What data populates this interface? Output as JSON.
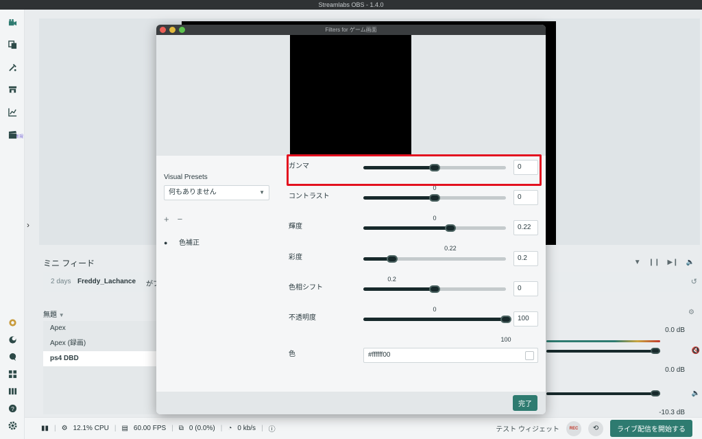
{
  "app": {
    "title": "Streamlabs OBS - 1.4.0"
  },
  "sidebar": {
    "icons": [
      "camera-icon",
      "copy-icon",
      "themes-icon",
      "store-icon",
      "chart-icon",
      "clapper-icon"
    ],
    "new_badge": "新規",
    "bottom_icons": [
      "studio-icon",
      "moon-icon",
      "chat-icon",
      "layout-icon",
      "library-icon",
      "help-icon",
      "settings-icon"
    ]
  },
  "mini_feed": {
    "title": "ミニ フィード",
    "row": {
      "time": "2 days",
      "user": "Freddy_Lachance",
      "text": "がフ"
    }
  },
  "scenes": {
    "selector": "無題",
    "items": [
      "Apex",
      "Apex (録画)",
      "ps4 DBD"
    ]
  },
  "mixer": {
    "db_values": [
      "0.0 dB",
      "0.0 dB",
      "-10.3 dB"
    ]
  },
  "statusbar": {
    "cpu": "12.1% CPU",
    "fps": "60.00 FPS",
    "dropped": "0 (0.0%)",
    "bitrate": "0 kb/s",
    "test_widget": "テスト ウィジェット",
    "rec_label": "REC",
    "go_live": "ライブ配信を開始する"
  },
  "modal": {
    "title": "Filters for ゲーム画面",
    "visual_presets_label": "Visual Presets",
    "visual_presets_value": "何もありません",
    "add_symbol": "+",
    "remove_symbol": "−",
    "filter_name": "色補正",
    "props": [
      {
        "label": "ガンマ",
        "value": "0",
        "fraction": 0.5
      },
      {
        "label": "コントラスト",
        "value": "0",
        "fraction": 0.5
      },
      {
        "label": "輝度",
        "value": "0.22",
        "fraction": 0.61
      },
      {
        "label": "彩度",
        "value": "0.2",
        "fraction": 0.2
      },
      {
        "label": "色相シフト",
        "value": "0",
        "fraction": 0.5
      },
      {
        "label": "不透明度",
        "value": "100",
        "fraction": 1.0
      }
    ],
    "color_label": "色",
    "color_value": "#ffffff00",
    "done_label": "完了"
  },
  "colors": {
    "accent": "#2e7b70",
    "highlight": "#e3101f"
  }
}
